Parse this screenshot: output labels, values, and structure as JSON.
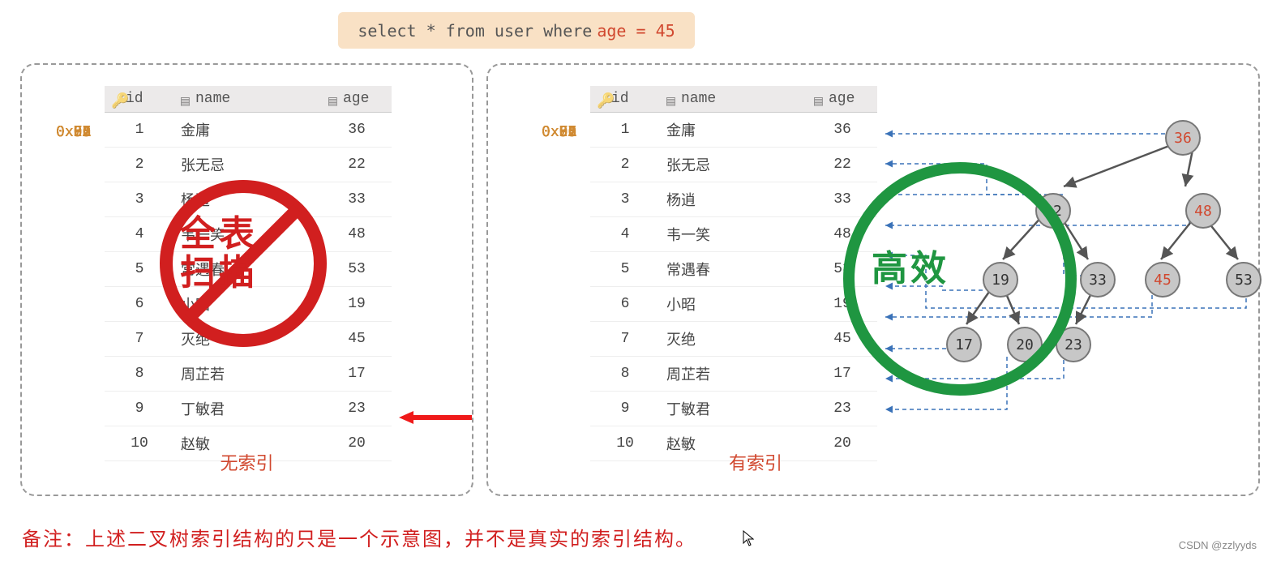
{
  "sql": {
    "prefix": "select * from user where",
    "highlight": "age = 45"
  },
  "columns": {
    "id": "id",
    "name": "name",
    "age": "age"
  },
  "rows": [
    {
      "addr": "0x07",
      "id": "1",
      "name": "金庸",
      "age": "36"
    },
    {
      "addr": "0x56",
      "id": "2",
      "name": "张无忌",
      "age": "22"
    },
    {
      "addr": "0x6A",
      "id": "3",
      "name": "杨逍",
      "age": "33"
    },
    {
      "addr": "0xF3",
      "id": "4",
      "name": "韦一笑",
      "age": "48"
    },
    {
      "addr": "0x90",
      "id": "5",
      "name": "常遇春",
      "age": "53"
    },
    {
      "addr": "0x77",
      "id": "6",
      "name": "小昭",
      "age": "19"
    },
    {
      "addr": "0xD1",
      "id": "7",
      "name": "灭绝",
      "age": "45"
    },
    {
      "addr": "0x32",
      "id": "8",
      "name": "周芷若",
      "age": "17"
    },
    {
      "addr": "0xE5",
      "id": "9",
      "name": "丁敏君",
      "age": "23"
    },
    {
      "addr": "0xF2",
      "id": "10",
      "name": "赵敏",
      "age": "20"
    }
  ],
  "captions": {
    "left": "无索引",
    "right": "有索引"
  },
  "badges": {
    "prohibit1": "全表",
    "prohibit2": "扫描",
    "effective": "高效"
  },
  "tree_nodes": {
    "n36": "36",
    "n22": "22",
    "n48": "48",
    "n19": "19",
    "n33": "33",
    "n45": "45",
    "n53": "53",
    "n17": "17",
    "n20": "20",
    "n23": "23"
  },
  "note": "备注：上述二叉树索引结构的只是一个示意图，并不是真实的索引结构。",
  "credit": "CSDN @zzlyyds"
}
